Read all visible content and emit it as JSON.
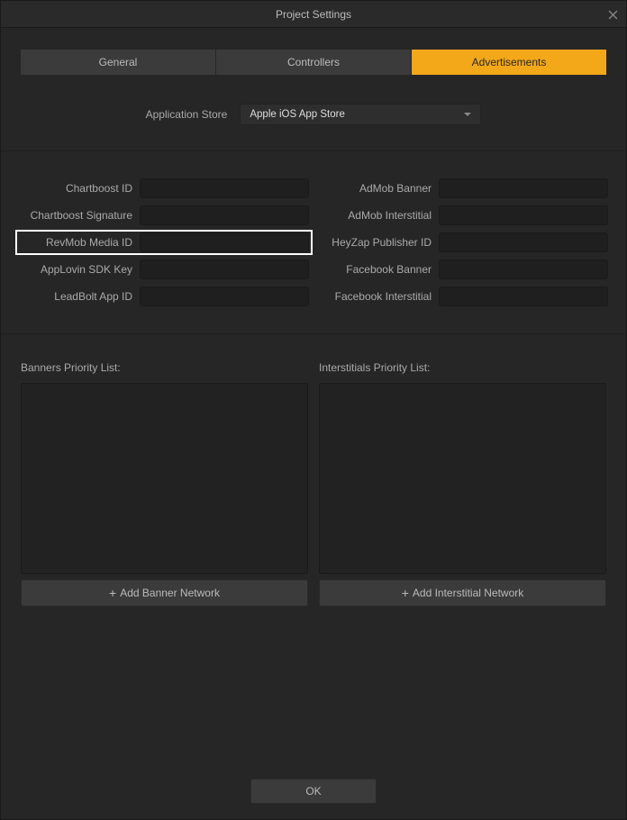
{
  "window": {
    "title": "Project Settings"
  },
  "tabs": {
    "general": "General",
    "controllers": "Controllers",
    "advertisements": "Advertisements"
  },
  "store": {
    "label": "Application Store",
    "selected": "Apple iOS App Store"
  },
  "fields": {
    "chartboost_id": {
      "label": "Chartboost ID",
      "value": ""
    },
    "chartboost_signature": {
      "label": "Chartboost Signature",
      "value": ""
    },
    "revmob_media_id": {
      "label": "RevMob Media ID",
      "value": ""
    },
    "applovin_sdk_key": {
      "label": "AppLovin SDK Key",
      "value": ""
    },
    "leadbolt_app_id": {
      "label": "LeadBolt App ID",
      "value": ""
    },
    "admob_banner": {
      "label": "AdMob Banner",
      "value": ""
    },
    "admob_interstitial": {
      "label": "AdMob Interstitial",
      "value": ""
    },
    "heyzap_publisher_id": {
      "label": "HeyZap Publisher ID",
      "value": ""
    },
    "facebook_banner": {
      "label": "Facebook Banner",
      "value": ""
    },
    "facebook_interstitial": {
      "label": "Facebook Interstitial",
      "value": ""
    }
  },
  "lists": {
    "banners_label": "Banners Priority List:",
    "interstitials_label": "Interstitials Priority List:",
    "add_banner": "Add Banner Network",
    "add_interstitial": "Add Interstitial Network"
  },
  "footer": {
    "ok": "OK"
  }
}
